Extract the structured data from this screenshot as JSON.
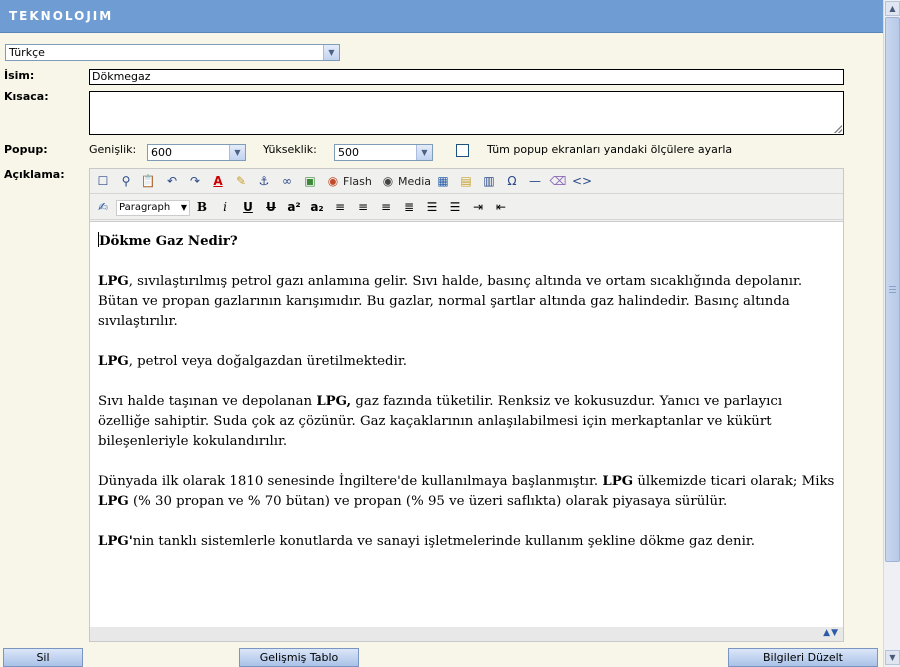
{
  "header": {
    "logo_text": "TEKNOLOJIM"
  },
  "language": {
    "selected": "Türkçe"
  },
  "fields": {
    "isim_label": "İsim:",
    "isim_value": "Dökmegaz",
    "kisaca_label": "Kısaca:",
    "popup_label": "Popup:",
    "genislik_label": "Genişlik:",
    "genislik_value": "600",
    "yukseklik_label": "Yükseklik:",
    "yukseklik_value": "500",
    "popup_all_label": "Tüm popup ekranları yandaki ölçülere ayarla",
    "aciklama_label": "Açıklama:"
  },
  "toolbar": {
    "flash_label": "Flash",
    "media_label": "Media",
    "format_value": "Paragraph"
  },
  "content": {
    "heading": "Dökme Gaz Nedir?",
    "p1_bold": "LPG",
    "p1_text": ", sıvılaştırılmış petrol gazı anlamına gelir. Sıvı halde, basınç altında ve ortam sıcaklığında depolanır. Bütan ve propan gazlarının karışımıdır. Bu gazlar, normal şartlar altında gaz halindedir. Basınç altında sıvılaştırılır.",
    "p2_bold": "LPG",
    "p2_text": ", petrol veya doğalgazdan üretilmektedir.",
    "p3_text_a": "Sıvı halde taşınan ve depolanan ",
    "p3_bold": "LPG,",
    "p3_text_b": " gaz fazında tüketilir. Renksiz ve kokusuzdur. Yanıcı ve parlayıcı özelliğe sahiptir. Suda çok az çözünür. Gaz kaçaklarının anlaşılabilmesi için merkaptanlar ve kükürt bileşenleriyle kokulandırılır.",
    "p4_text_a": "Dünyada ilk olarak 1810 senesinde İngiltere'de kullanılmaya başlanmıştır. ",
    "p4_bold_a": "LPG",
    "p4_text_b": " ülkemizde ticari olarak; Miks ",
    "p4_bold_b": "LPG",
    "p4_text_c": " (% 30 propan ve % 70 bütan) ve propan (% 95 ve üzeri saflıkta) olarak piyasaya sürülür.",
    "p5_bold": "LPG'",
    "p5_text": "nin tanklı sistemlerle konutlarda ve sanayi işletmelerinde kullanım şekline dökme gaz denir."
  },
  "buttons": {
    "sil": "Sil",
    "gelismis_tablo": "Gelişmiş Tablo",
    "bilgileri_duzelt": "Bilgileri Düzelt"
  },
  "colors": {
    "header": "#6f9cd2",
    "background": "#f7f6e8"
  }
}
